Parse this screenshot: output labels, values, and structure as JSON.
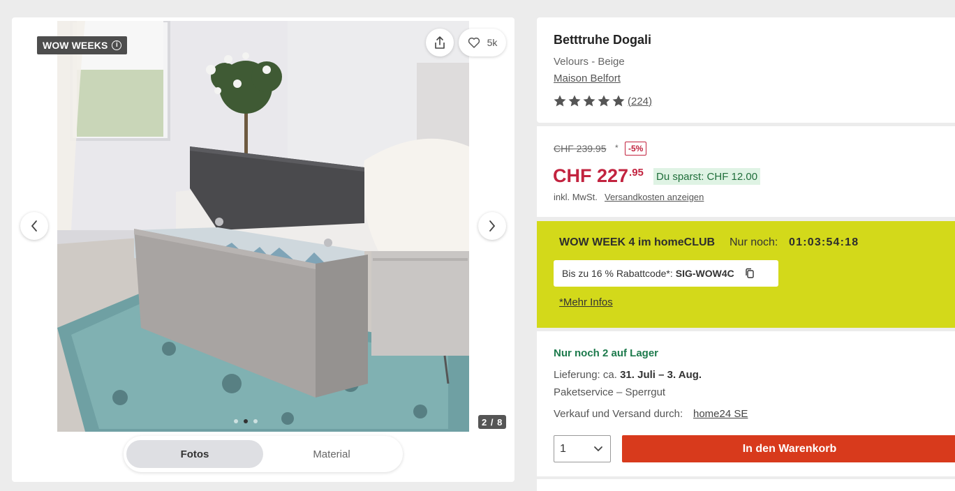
{
  "gallery": {
    "badge_label": "WOW WEEKS",
    "badge_info_glyph": "i",
    "favorites_count": "5k",
    "counter": "2 / 8",
    "tabs": [
      {
        "label": "Fotos",
        "active": true
      },
      {
        "label": "Material",
        "active": false
      }
    ],
    "image_description": "product photo: upholstered storage bench with open lid at foot of bed on turquoise rug"
  },
  "product": {
    "title": "Betttruhe Dogali",
    "variant": "Velours - Beige",
    "brand": "Maison Belfort",
    "rating_stars": 5,
    "rating_count": "(224)"
  },
  "price": {
    "old_price": "CHF 239.95",
    "old_price_marker": "*",
    "discount_badge": "-5%",
    "main": "CHF 227",
    "cents": ".95",
    "savings": "Du sparst: CHF 12.00",
    "tax_note": "inkl. MwSt.",
    "shipping_link": "Versandkosten anzeigen"
  },
  "promo": {
    "title": "WOW WEEK 4 im homeCLUB",
    "remaining_label": "Nur noch:",
    "timer": "01:03:54:18",
    "code_prefix": "Bis zu 16 % Rabattcode*:",
    "code": "SIG-WOW4C",
    "more_info": "*Mehr Infos"
  },
  "availability": {
    "stock": "Nur noch 2 auf Lager",
    "delivery_prefix": "Lieferung: ca.",
    "delivery_dates": "31. Juli – 3. Aug.",
    "service": "Paketservice – Sperrgut",
    "seller_prefix": "Verkauf und Versand durch:",
    "seller_link": "home24 SE",
    "quantity": "1",
    "add_to_cart": "In den Warenkorb"
  },
  "colors": {
    "accent_red": "#c2233f",
    "cart_button": "#d83a1c",
    "promo_bg": "#d3d91a",
    "stock_green": "#1d7a4c",
    "rating_star": "#555555"
  }
}
